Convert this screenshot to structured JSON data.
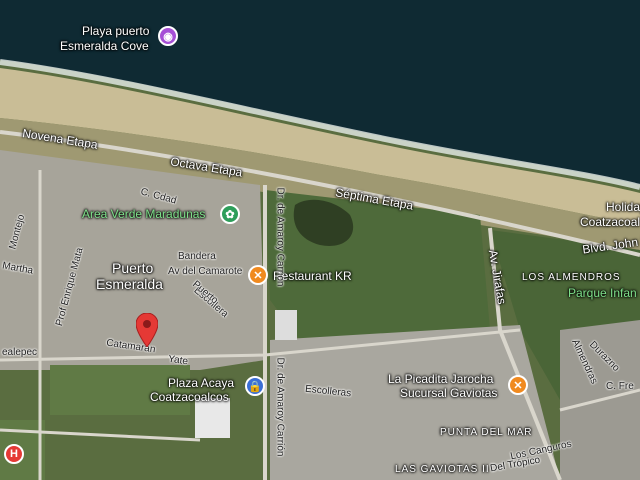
{
  "labels": {
    "playa_line1": "Playa puerto",
    "playa_line2": "Esmeralda Cove",
    "novena": "Novena Etapa",
    "octava": "Octava Etapa",
    "septima": "Séptima Etapa",
    "area_verde": "Area Verde Maradunas",
    "puerto_line1": "Puerto",
    "puerto_line2": "Esmeralda",
    "restaurant": "Restaurant KR",
    "plaza_line1": "Plaza Acaya",
    "plaza_line2": "Coatzacoalcos",
    "picadita_line1": "La Picadita Jarocha",
    "picadita_line2": "Sucursal Gaviotas",
    "holiday_line1": "Holiday",
    "holiday_line2": "Coatzacoal",
    "los_almendros": "LOS ALMENDROS",
    "parque": "Parque Infan",
    "punta_del_mar": "PUNTA DEL MAR",
    "las_gaviotas": "LAS GAVIOTAS II",
    "blvd_john": "Blvd. John Spa",
    "av_jirafas": "Av. Jirafas",
    "dr_amaroy_top": "Dr. de Amaroy Carrión",
    "dr_amaroy_bottom": "Dr. de Amaroy Carrión",
    "catamaran": "Catamarán",
    "yate": "Yate",
    "escolleras_1": "Escolleras",
    "escolleras_2": "Escollera",
    "bandera": "Bandera",
    "av_camarote": "Av del Camarote",
    "cdad": "C. Cdad",
    "puerto_street": "Puerto",
    "prof_mata": "Prof Enrique Mata",
    "montejo": "Montejo",
    "martha": "Martha",
    "ealepec": "ealepec",
    "durazno": "Durazno",
    "almendras": "Almendras",
    "c_fre": "C. Fre",
    "del_tropico": "Del Trópico",
    "los_cangurus": "Los Canguros"
  },
  "icons": {
    "restaurant": "fork-knife-icon",
    "camera": "camera-icon",
    "park": "park-icon",
    "shopping": "shopping-bag-icon",
    "hospital": "hospital-icon",
    "pin": "map-pin-icon"
  },
  "colors": {
    "ocean": "#0f2a33",
    "sand": "#c9bd96",
    "vegetation": "#4e6a3a",
    "urban": "#9e9e96",
    "poi_orange": "#f08a1f",
    "poi_purple": "#a64fd6",
    "poi_green": "#2e9e5a",
    "poi_blue": "#3b6fd6",
    "pin_red": "#e53935"
  }
}
